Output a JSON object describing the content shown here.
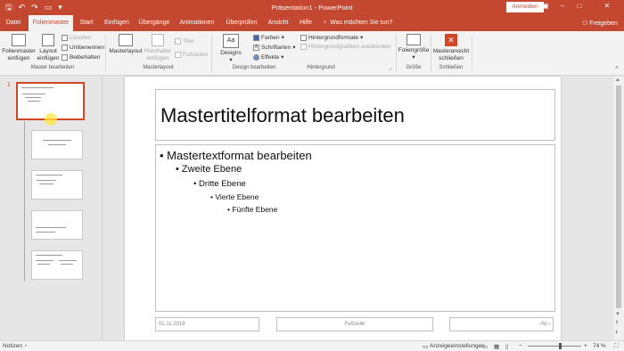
{
  "titlebar": {
    "title": "Präsentation1 - PowerPoint",
    "signin": "Anmelden"
  },
  "tabs": [
    "Datei",
    "Folienmaster",
    "Start",
    "Einfügen",
    "Übergänge",
    "Animationen",
    "Überprüfen",
    "Ansicht",
    "Hilfe"
  ],
  "tellme": "Was möchten Sie tun?",
  "share": "Freigeben",
  "ribbon": {
    "groups": {
      "master_edit": "Master bearbeiten",
      "masterlayout": "Masterlayout",
      "design_edit": "Design bearbeiten",
      "background": "Hintergrund",
      "size": "Größe",
      "close": "Schließen"
    },
    "slide_master_insert": [
      "Folienmaster",
      "einfügen"
    ],
    "layout_insert": [
      "Layout",
      "einfügen"
    ],
    "delete": "Löschen",
    "rename": "Umbenennen",
    "preserve": "Beibehalten",
    "masterlayout": "Masterlayout",
    "placeholder_insert": [
      "Platzhalter",
      "einfügen"
    ],
    "title_cb": "Titel",
    "footer_cb": "Fußzeilen",
    "designs": "Designs",
    "colors": "Farben",
    "fonts": "Schriftarten",
    "effects": "Effekte",
    "bg_formats": "Hintergrundformate",
    "hide_bg": "Hintergrundgrafiken ausblenden",
    "slide_size": "Foliengröße",
    "close_master": [
      "Masteransicht",
      "schließen"
    ]
  },
  "thumbnails": {
    "number": "1"
  },
  "slide": {
    "title": "Mastertitelformat bearbeiten",
    "levels": [
      "Mastertextformat bearbeiten",
      "Zweite Ebene",
      "Dritte Ebene",
      "Vierte Ebene",
      "Fünfte Ebene"
    ],
    "date": "01.11.2019",
    "footer": "Fußzeile",
    "number": "‹Nr.›"
  },
  "status": {
    "notes": "Notizen",
    "display_settings": "Anzeigeeinstellungen",
    "zoom": "74 %"
  },
  "colors": {
    "accent": "#c4472f"
  }
}
